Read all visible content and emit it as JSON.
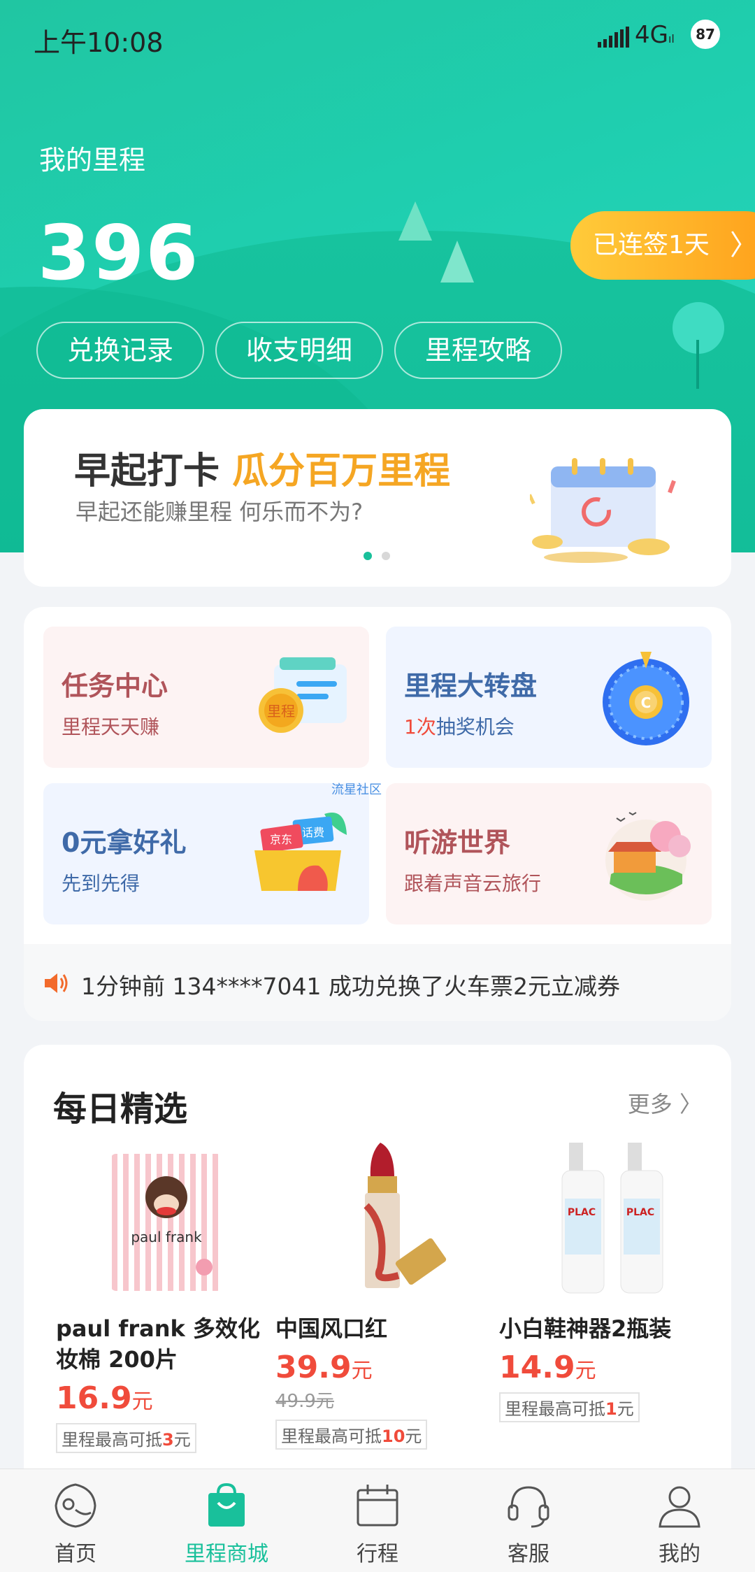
{
  "status_bar": {
    "time": "上午10:08",
    "network": "4G",
    "battery": "87"
  },
  "header": {
    "title": "我的里程",
    "miles": "396",
    "sign_in": "已连签1天",
    "actions": [
      "兑换记录",
      "收支明细",
      "里程攻略"
    ]
  },
  "banner": {
    "title_main": "早起打卡",
    "title_highlight": "瓜分百万里程",
    "subtitle": "早起还能赚里程 何乐而不为?",
    "page_dots": 2,
    "active_dot": 0
  },
  "tiles": [
    {
      "title": "任务中心",
      "subtitle": "里程天天赚",
      "badge": "里程"
    },
    {
      "title": "里程大转盘",
      "subtitle_count": "1次",
      "subtitle": "抽奖机会"
    },
    {
      "title": "0元拿好礼",
      "subtitle": "先到先得",
      "box_labels": [
        "京东",
        "话费"
      ]
    },
    {
      "title": "听游世界",
      "subtitle": "跟着声音云旅行"
    }
  ],
  "watermark": "流星社区",
  "ticker": {
    "message": "1分钟前 134****7041 成功兑换了火车票2元立减券"
  },
  "daily": {
    "title": "每日精选",
    "more": "更多",
    "products": [
      {
        "name": "paul frank 多效化妆棉 200片",
        "price": "16.9",
        "unit": "元",
        "old_price": "",
        "tag_prefix": "里程最高可抵",
        "tag_value": "3",
        "tag_suffix": "元",
        "package_brand": "paul frank"
      },
      {
        "name": "中国风口红",
        "price": "39.9",
        "unit": "元",
        "old_price": "49.9元",
        "tag_prefix": "里程最高可抵",
        "tag_value": "10",
        "tag_suffix": "元"
      },
      {
        "name": "小白鞋神器2瓶装",
        "price": "14.9",
        "unit": "元",
        "old_price": "",
        "tag_prefix": "里程最高可抵",
        "tag_value": "1",
        "tag_suffix": "元",
        "bottle_label": "PLAC"
      }
    ]
  },
  "tabbar": {
    "tabs": [
      {
        "label": "首页",
        "icon": "home-icon"
      },
      {
        "label": "里程商城",
        "icon": "shopping-bag-icon"
      },
      {
        "label": "行程",
        "icon": "calendar-icon"
      },
      {
        "label": "客服",
        "icon": "headset-icon"
      },
      {
        "label": "我的",
        "icon": "person-icon"
      }
    ],
    "active_index": 1
  },
  "colors": {
    "brand_green": "#19c09b",
    "accent_orange": "#f5a623",
    "price_red": "#f04b3b"
  }
}
